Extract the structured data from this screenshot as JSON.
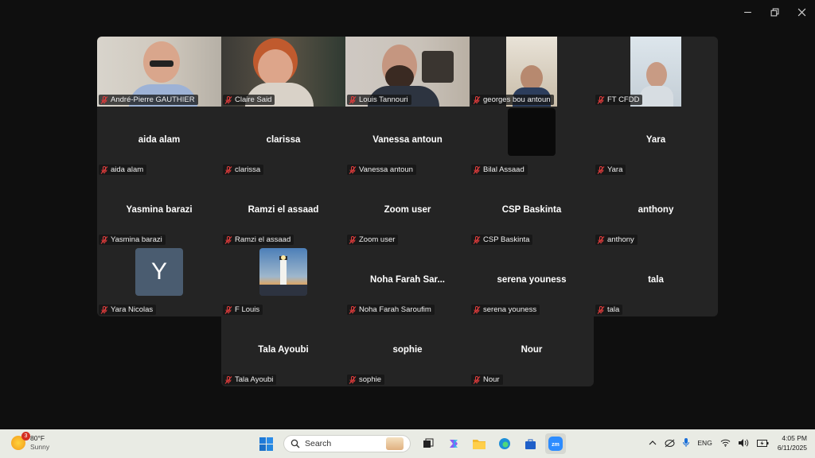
{
  "participants": [
    {
      "name": "André-Pierre GAUTHIER",
      "display": "",
      "video": "video-andre"
    },
    {
      "name": "Claire Said",
      "display": "",
      "video": "video-claire"
    },
    {
      "name": "Louis Tannouri",
      "display": "",
      "video": "video-louis",
      "active": true
    },
    {
      "name": "georges bou antoun",
      "display": "",
      "video": "video-georges"
    },
    {
      "name": "FT CFDD",
      "display": "",
      "video": "video-ft"
    },
    {
      "name": "aida alam",
      "display": "aida alam"
    },
    {
      "name": "clarissa",
      "display": "clarissa"
    },
    {
      "name": "Vanessa antoun",
      "display": "Vanessa antoun"
    },
    {
      "name": "Bilal Assaad",
      "display": "",
      "avatar": "black"
    },
    {
      "name": "Yara",
      "display": "Yara"
    },
    {
      "name": "Yasmina barazi",
      "display": "Yasmina barazi"
    },
    {
      "name": "Ramzi el assaad",
      "display": "Ramzi el assaad"
    },
    {
      "name": "Zoom user",
      "display": "Zoom user"
    },
    {
      "name": "CSP Baskinta",
      "display": "CSP Baskinta"
    },
    {
      "name": "anthony",
      "display": "anthony"
    },
    {
      "name": "Yara Nicolas",
      "display": "",
      "avatar": "letter",
      "avatar_letter": "Y"
    },
    {
      "name": "F Louis",
      "display": "",
      "avatar": "lighthouse"
    },
    {
      "name": "Noha Farah Saroufim",
      "display": "Noha Farah Sar..."
    },
    {
      "name": "serena youness",
      "display": "serena youness"
    },
    {
      "name": "tala",
      "display": "tala"
    },
    {
      "name": "Tala Ayoubi",
      "display": "Tala Ayoubi"
    },
    {
      "name": "sophie",
      "display": "sophie"
    },
    {
      "name": "Nour",
      "display": "Nour"
    }
  ],
  "weather": {
    "temp": "80°F",
    "condition": "Sunny",
    "badge": "3"
  },
  "taskbar": {
    "search_placeholder": "Search"
  },
  "tray": {
    "language": "ENG",
    "time": "4:05 PM",
    "date": "6/11/2025"
  },
  "colors": {
    "active_speaker": "#3fc26b",
    "tile_bg": "#242424",
    "muted_mic": "#e03c3c"
  }
}
